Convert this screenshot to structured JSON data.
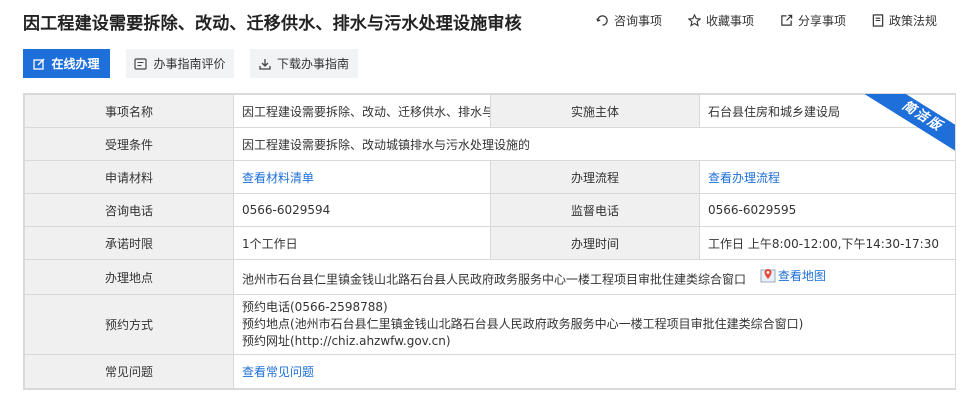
{
  "page": {
    "title": "因工程建设需要拆除、改动、迁移供水、排水与污水处理设施审核"
  },
  "top_actions": [
    {
      "label": "咨询事项",
      "icon": "consult-icon"
    },
    {
      "label": "收藏事项",
      "icon": "star-icon"
    },
    {
      "label": "分享事项",
      "icon": "share-icon"
    },
    {
      "label": "政策法规",
      "icon": "document-icon"
    }
  ],
  "buttons": {
    "online": "在线办理",
    "evaluate": "办事指南评价",
    "download": "下载办事指南"
  },
  "ribbon": "简洁版",
  "rows": {
    "item_name": {
      "label": "事项名称",
      "value": "因工程建设需要拆除、改动、迁移供水、排水与..."
    },
    "agency": {
      "label": "实施主体",
      "value": "石台县住房和城乡建设局"
    },
    "conditions": {
      "label": "受理条件",
      "value": "因工程建设需要拆除、改动城镇排水与污水处理设施的"
    },
    "materials": {
      "label": "申请材料",
      "value": "查看材料清单"
    },
    "process": {
      "label": "办理流程",
      "value": "查看办理流程"
    },
    "phone": {
      "label": "咨询电话",
      "value": "0566-6029594"
    },
    "supervise": {
      "label": "监督电话",
      "value": "0566-6029595"
    },
    "limit": {
      "label": "承诺时限",
      "value": "1个工作日"
    },
    "hours": {
      "label": "办理时间",
      "value": "工作日 上午8:00-12:00,下午14:30-17:30"
    },
    "location": {
      "label": "办理地点",
      "value": "池州市石台县仁里镇金钱山北路石台县人民政府政务服务中心一楼工程项目审批住建类综合窗口",
      "map": "查看地图"
    },
    "appointment": {
      "label": "预约方式",
      "lines": [
        "预约电话(0566-2598788)",
        "预约地点(池州市石台县仁里镇金钱山北路石台县人民政府政务服务中心一楼工程项目审批住建类综合窗口)",
        "预约网址(http://chiz.ahzwfw.gov.cn)"
      ]
    },
    "faq": {
      "label": "常见问题",
      "value": "查看常见问题"
    }
  },
  "colors": {
    "accent": "#1e6fd9",
    "label_bg": "#f0f0f0",
    "border": "#d9d9d9"
  }
}
